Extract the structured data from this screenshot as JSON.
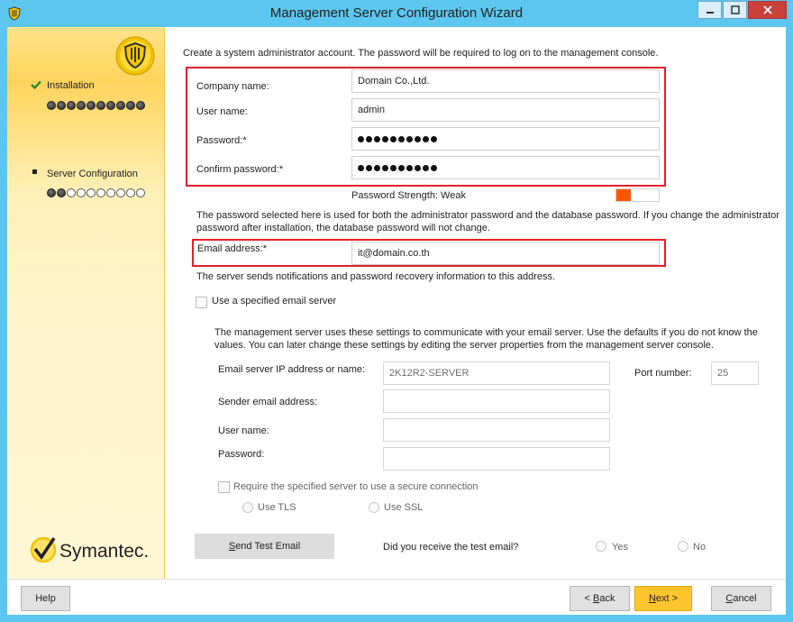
{
  "window": {
    "title": "Management Server Configuration Wizard"
  },
  "sidebar": {
    "steps": [
      {
        "label": "Installation",
        "status": "done",
        "progress_filled": 10,
        "progress_total": 10
      },
      {
        "label": "Server Configuration",
        "status": "current",
        "progress_filled": 2,
        "progress_total": 10
      }
    ],
    "logo_text": "Symantec."
  },
  "main": {
    "intro": "Create a system administrator account. The password will be required to log on to the management console.",
    "company_label": "Company name:",
    "company_value": "Domain Co.,Ltd.",
    "username_label": "User name:",
    "username_value": "admin",
    "password_label": "Password:*",
    "confirm_label": "Confirm password:*",
    "strength_label": "Password Strength: Weak",
    "strength_level": 0.33,
    "password_note": "The password selected here is used for both the administrator password and the database password. If you change the administrator password after installation, the database password will not change.",
    "email_label": "Email address:*",
    "email_value": "it@domain.co.th",
    "email_note": "The server sends notifications and password recovery information to this address.",
    "use_server_label": "Use a specified email server",
    "server_note": "The management server uses these settings to communicate with your email server.  Use the defaults if you do not know the values. You can later change these settings by editing the server properties from the management server console.",
    "server_ip_label": "Email server IP address or name:",
    "server_ip_value": "2K12R2-SERVER",
    "port_label": "Port number:",
    "port_value": "25",
    "sender_label": "Sender email address:",
    "smtp_user_label": "User name:",
    "smtp_pass_label": "Password:",
    "secure_label": "Require the specified server to use a secure connection",
    "tls_label": "Use TLS",
    "ssl_label": "Use SSL",
    "test_button": "Send Test Email",
    "received_question": "Did you receive the test email?",
    "yes_label": "Yes",
    "no_label": "No"
  },
  "footer": {
    "help": "Help",
    "back": "< Back",
    "next": "Next >",
    "cancel": "Cancel"
  },
  "colors": {
    "accent": "#fec52e",
    "highlight_box": "#e4202b",
    "titlebar": "#5cc6ee",
    "strength": "#ff5500"
  }
}
